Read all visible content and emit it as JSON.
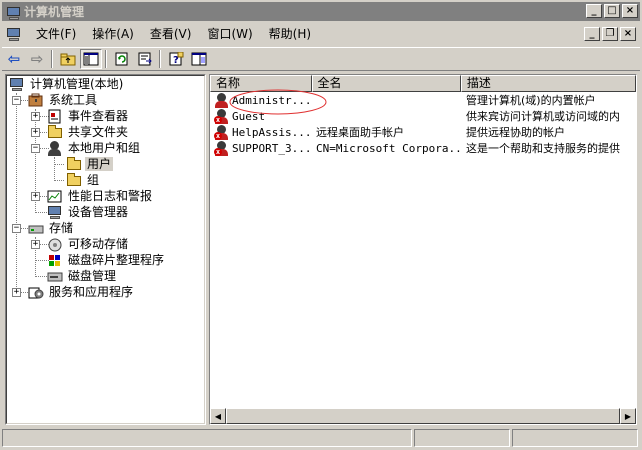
{
  "window": {
    "title": "计算机管理"
  },
  "title_buttons": {
    "minimize": "_",
    "maximize": "□",
    "close": "×"
  },
  "menu": [
    "文件(F)",
    "操作(A)",
    "查看(V)",
    "窗口(W)",
    "帮助(H)"
  ],
  "mdi_buttons": {
    "minimize": "_",
    "restore": "❐",
    "close": "×"
  },
  "toolbar": {
    "icons": [
      "back-arrow-icon",
      "forward-arrow-icon",
      "up-folder-icon",
      "show-hide-tree-icon",
      "refresh-icon",
      "export-list-icon",
      "help-icon",
      "properties-icon"
    ],
    "back": "⇦",
    "forward": "⇨"
  },
  "tree": {
    "root": "计算机管理(本地)",
    "system_tools": "系统工具",
    "event_viewer": "事件查看器",
    "shared_folders": "共享文件夹",
    "local_users_groups": "本地用户和组",
    "users": "用户",
    "groups": "组",
    "perf_logs": "性能日志和警报",
    "device_manager": "设备管理器",
    "storage": "存储",
    "removable_storage": "可移动存储",
    "defrag": "磁盘碎片整理程序",
    "disk_mgmt": "磁盘管理",
    "services_apps": "服务和应用程序"
  },
  "list": {
    "columns": [
      "名称",
      "全名",
      "描述"
    ],
    "rows": [
      {
        "name": "Administr...",
        "fullname": "",
        "desc": "管理计算机(域)的内置帐户",
        "disabled": false
      },
      {
        "name": "Guest",
        "fullname": "",
        "desc": "供来宾访问计算机或访问域的内",
        "disabled": true
      },
      {
        "name": "HelpAssis...",
        "fullname": "远程桌面助手帐户",
        "desc": "提供远程协助的帐户",
        "disabled": true
      },
      {
        "name": "SUPPORT_3...",
        "fullname": "CN=Microsoft Corpora...",
        "desc": "这是一个帮助和支持服务的提供",
        "disabled": true
      }
    ]
  },
  "colors": {
    "titlebar_inactive": "#808080",
    "face": "#d4d0c8",
    "annotation_circle": "#e03030"
  }
}
